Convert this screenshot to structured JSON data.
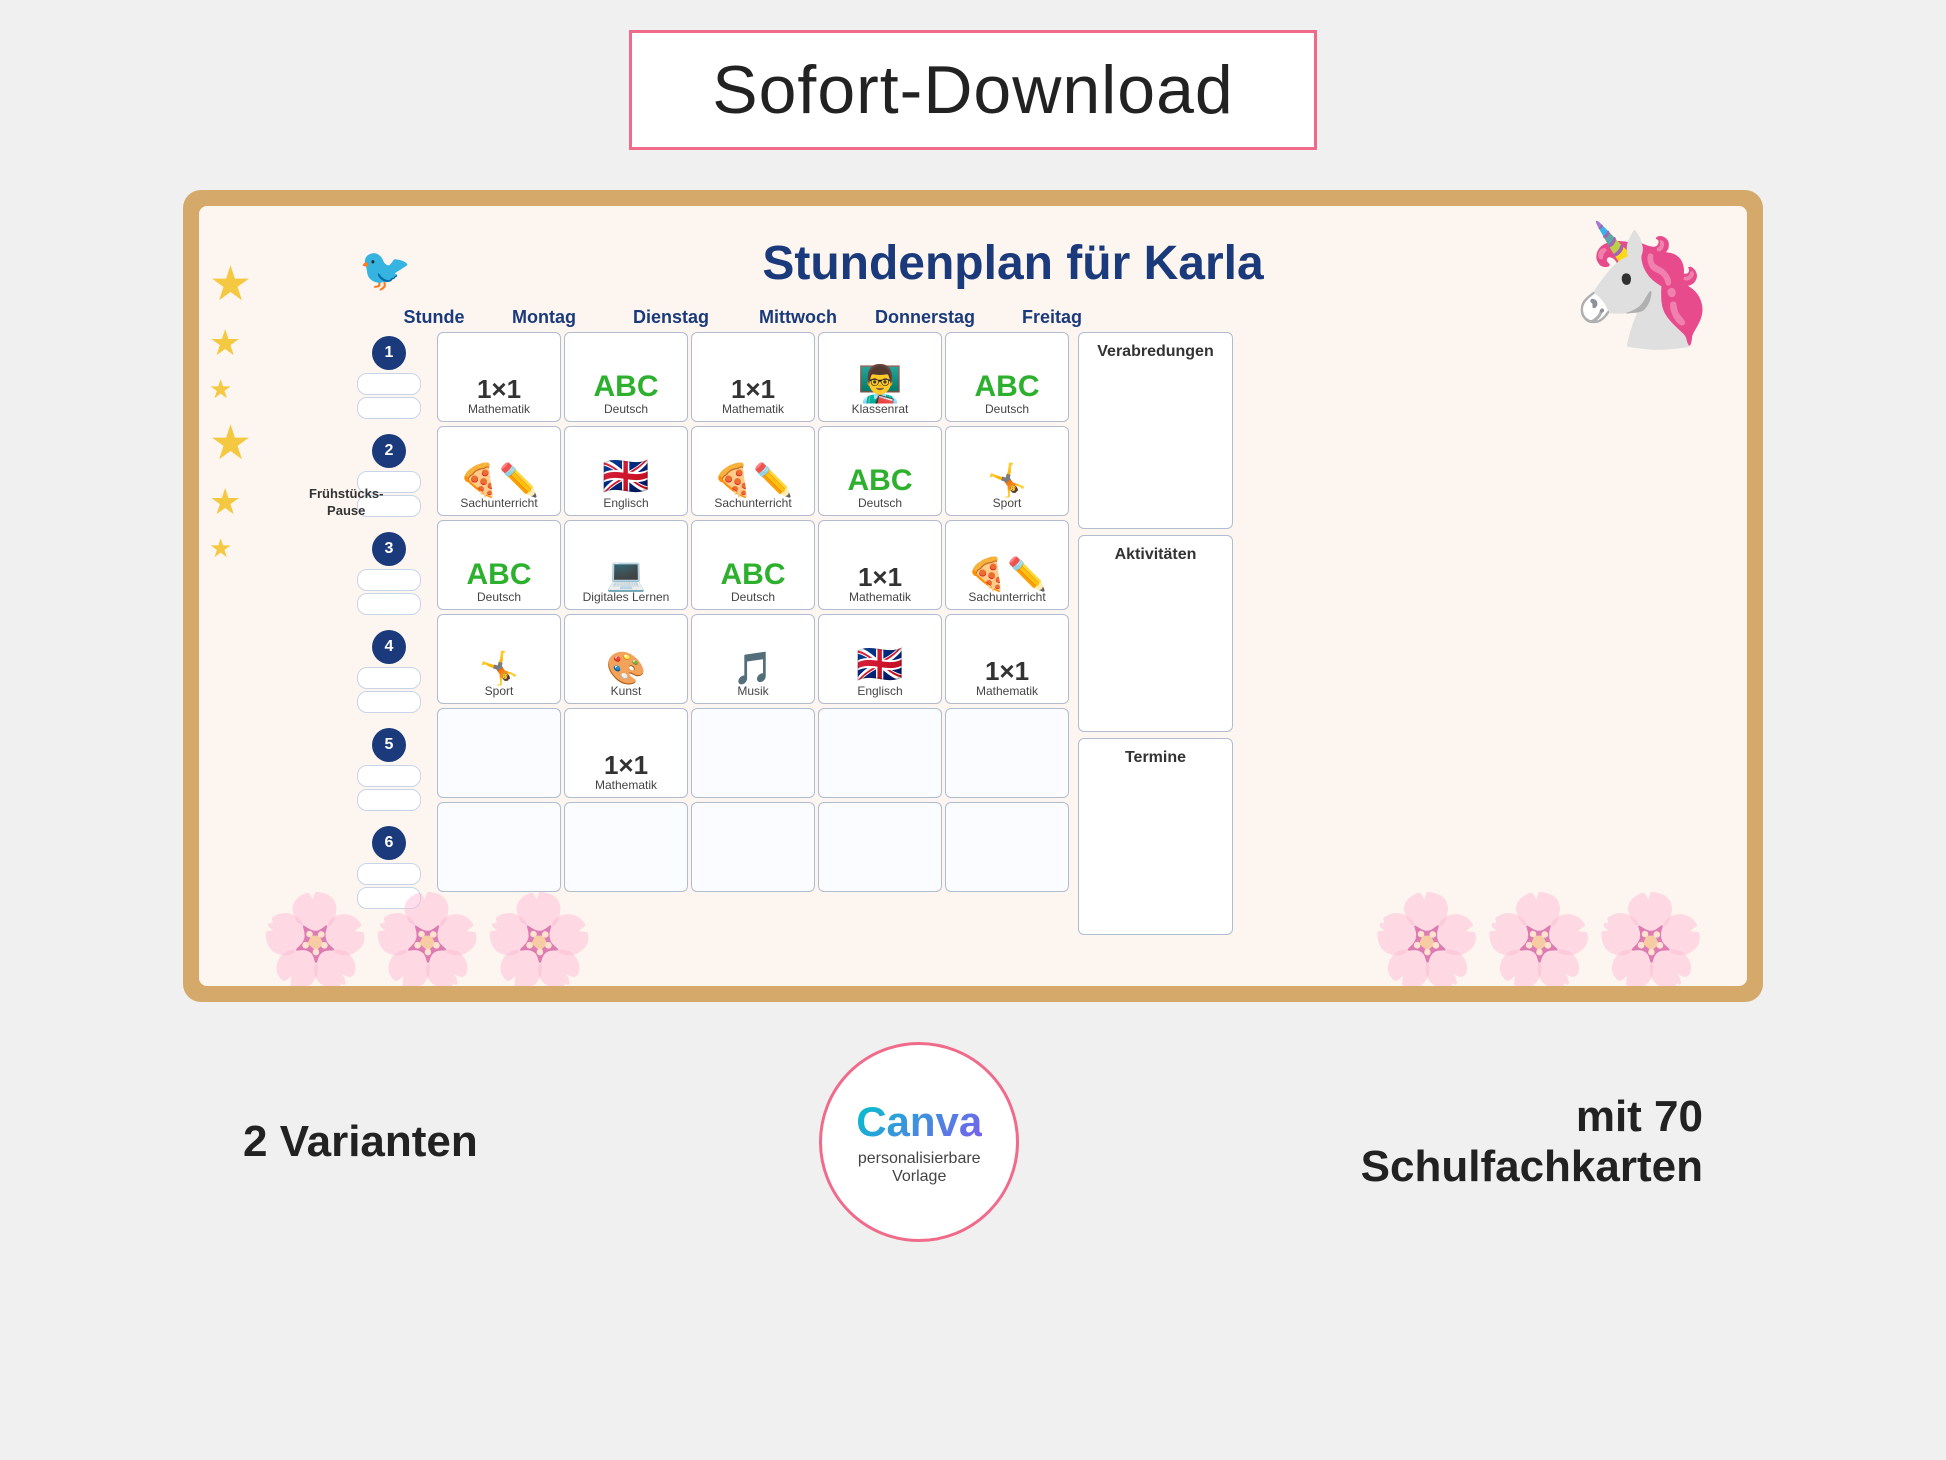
{
  "top_banner": {
    "title": "Sofort-Download"
  },
  "schedule": {
    "title": "Stundenplan für Karla",
    "header_cols": [
      "Stunde",
      "Montag",
      "Dienstag",
      "Mittwoch",
      "Donnerstag",
      "Freitag"
    ],
    "rows": [
      {
        "number": "1",
        "cells": [
          {
            "icon": "math",
            "label": "Mathematik"
          },
          {
            "icon": "abc",
            "label": "Deutsch"
          },
          {
            "icon": "math",
            "label": "Mathematik"
          },
          {
            "icon": "klassenrat",
            "label": "Klassenrat"
          },
          {
            "icon": "abc",
            "label": "Deutsch"
          }
        ]
      },
      {
        "number": "2",
        "cells": [
          {
            "icon": "sachunterricht",
            "label": "Sachunterricht"
          },
          {
            "icon": "englisch",
            "label": "Englisch"
          },
          {
            "icon": "sachunterricht",
            "label": "Sachunterricht"
          },
          {
            "icon": "abc",
            "label": "Deutsch"
          },
          {
            "icon": "sport",
            "label": "Sport"
          }
        ]
      },
      {
        "number": "3",
        "cells": [
          {
            "icon": "abc",
            "label": "Deutsch"
          },
          {
            "icon": "digitales",
            "label": "Digitales Lernen"
          },
          {
            "icon": "abc",
            "label": "Deutsch"
          },
          {
            "icon": "math",
            "label": "Mathematik"
          },
          {
            "icon": "sachunterricht",
            "label": "Sachunterricht"
          }
        ]
      },
      {
        "number": "4",
        "cells": [
          {
            "icon": "sport",
            "label": "Sport"
          },
          {
            "icon": "kunst",
            "label": "Kunst"
          },
          {
            "icon": "musik",
            "label": "Musik"
          },
          {
            "icon": "englisch",
            "label": "Englisch"
          },
          {
            "icon": "math",
            "label": "Mathematik"
          }
        ]
      },
      {
        "number": "5",
        "cells": [
          {
            "icon": "empty",
            "label": ""
          },
          {
            "icon": "math",
            "label": "Mathematik"
          },
          {
            "icon": "empty",
            "label": ""
          },
          {
            "icon": "empty",
            "label": ""
          },
          {
            "icon": "empty",
            "label": ""
          }
        ]
      },
      {
        "number": "6",
        "cells": [
          {
            "icon": "empty",
            "label": ""
          },
          {
            "icon": "empty",
            "label": ""
          },
          {
            "icon": "empty",
            "label": ""
          },
          {
            "icon": "empty",
            "label": ""
          },
          {
            "icon": "empty",
            "label": ""
          }
        ]
      }
    ],
    "side_boxes": [
      "Verabredungen",
      "Aktivitäten",
      "Termine"
    ],
    "fruehstueck_label": "Frühstücks-\nPause"
  },
  "bottom": {
    "left_label": "2 Varianten",
    "canva_logo": "Canva",
    "canva_sub1": "personalisierbare",
    "canva_sub2": "Vorlage",
    "right_label": "mit 70",
    "right_label2": "Schulfachkarten"
  }
}
